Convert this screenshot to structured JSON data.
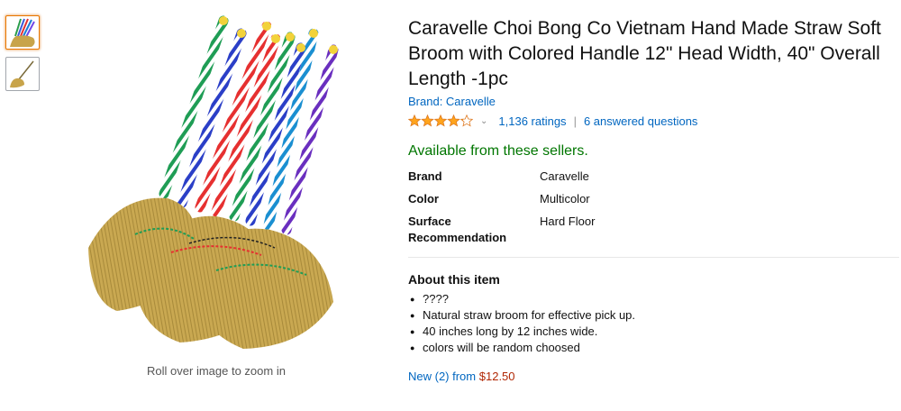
{
  "thumbnails": [
    {
      "name": "thumb-multiple-brooms",
      "active": true
    },
    {
      "name": "thumb-single-broom",
      "active": false
    }
  ],
  "gallery": {
    "zoom_hint": "Roll over image to zoom in"
  },
  "product": {
    "title": "Caravelle Choi Bong Co Vietnam Hand Made Straw Soft Broom with Colored Handle 12\" Head Width, 40\" Overall Length -1pc",
    "brand_link": "Brand: Caravelle",
    "rating": {
      "stars": 4.2,
      "ratings_link": "1,136 ratings",
      "separator": "|",
      "questions_link": "6 answered questions"
    },
    "availability": "Available from these sellers.",
    "specs": [
      {
        "key": "Brand",
        "value": "Caravelle"
      },
      {
        "key": "Color",
        "value": "Multicolor"
      },
      {
        "key": "Surface Recommendation",
        "value": "Hard Floor"
      }
    ],
    "about_heading": "About this item",
    "bullets": [
      "????",
      "Natural straw broom for effective pick up.",
      "40 inches long by 12 inches wide.",
      "colors will be random choosed"
    ],
    "offer": {
      "prefix": "New (2) from",
      "price": "$12.50"
    }
  },
  "colors": {
    "link": "#0066c0",
    "availability": "#007600",
    "price": "#b12704",
    "star": "#ffa41c"
  }
}
